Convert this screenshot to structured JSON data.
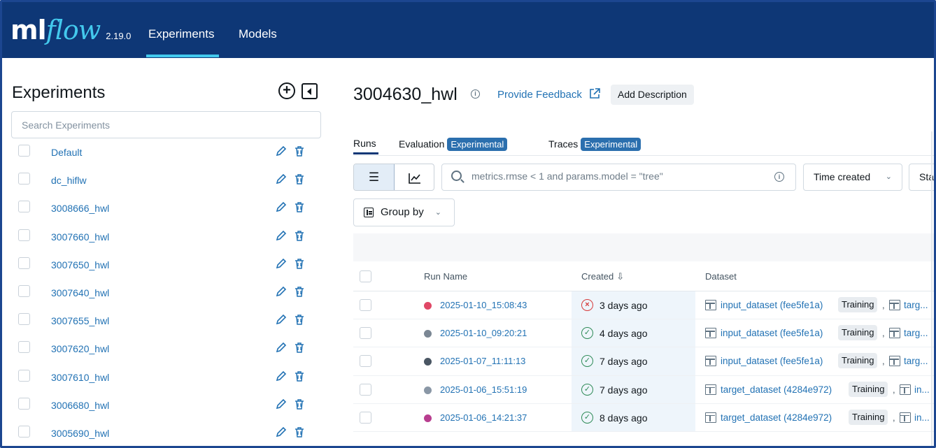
{
  "header": {
    "logo_ml": "ml",
    "logo_flow": "flow",
    "version": "2.19.0",
    "nav": [
      {
        "label": "Experiments",
        "active": true
      },
      {
        "label": "Models",
        "active": false
      }
    ],
    "colors": {
      "bar": "#0e3776",
      "accent": "#43c9ed"
    }
  },
  "sidebar": {
    "title": "Experiments",
    "search_placeholder": "Search Experiments",
    "experiments": [
      {
        "name": "Default"
      },
      {
        "name": "dc_hiflw"
      },
      {
        "name": "3008666_hwl"
      },
      {
        "name": "3007660_hwl"
      },
      {
        "name": "3007650_hwl"
      },
      {
        "name": "3007640_hwl"
      },
      {
        "name": "3007655_hwl"
      },
      {
        "name": "3007620_hwl"
      },
      {
        "name": "3007610_hwl"
      },
      {
        "name": "3006680_hwl"
      },
      {
        "name": "3005690_hwl"
      }
    ]
  },
  "main": {
    "title": "3004630_hwl",
    "feedback_label": "Provide Feedback",
    "add_description_label": "Add Description",
    "tabs": [
      {
        "label": "Runs",
        "badge": ""
      },
      {
        "label": "Evaluation",
        "badge": "Experimental"
      },
      {
        "label": "Traces",
        "badge": "Experimental"
      }
    ],
    "search_placeholder": "metrics.rmse < 1 and params.model = \"tree\"",
    "sort_label": "Time created",
    "status_label": "Sta",
    "group_by_label": "Group by",
    "table": {
      "columns": [
        "Run Name",
        "Created",
        "Dataset"
      ],
      "rows": [
        {
          "run_name": "2025-01-10_15:08:43",
          "dot_color": "#e04866",
          "status": "failed",
          "status_glyph": "×",
          "created": "3 days ago",
          "dataset": "input_dataset (fee5fe1a)",
          "tag": "Training",
          "more": "targ..."
        },
        {
          "run_name": "2025-01-10_09:20:21",
          "dot_color": "#7b8794",
          "status": "finished",
          "status_glyph": "✓",
          "created": "4 days ago",
          "dataset": "input_dataset (fee5fe1a)",
          "tag": "Training",
          "more": "targ..."
        },
        {
          "run_name": "2025-01-07_11:11:13",
          "dot_color": "#4a5663",
          "status": "finished",
          "status_glyph": "✓",
          "created": "7 days ago",
          "dataset": "input_dataset (fee5fe1a)",
          "tag": "Training",
          "more": "targ..."
        },
        {
          "run_name": "2025-01-06_15:51:19",
          "dot_color": "#8a97a6",
          "status": "finished",
          "status_glyph": "✓",
          "created": "7 days ago",
          "dataset": "target_dataset (4284e972)",
          "tag": "Training",
          "more": "in..."
        },
        {
          "run_name": "2025-01-06_14:21:37",
          "dot_color": "#b83e8f",
          "status": "finished",
          "status_glyph": "✓",
          "created": "8 days ago",
          "dataset": "target_dataset (4284e972)",
          "tag": "Training",
          "more": "in..."
        }
      ]
    }
  }
}
